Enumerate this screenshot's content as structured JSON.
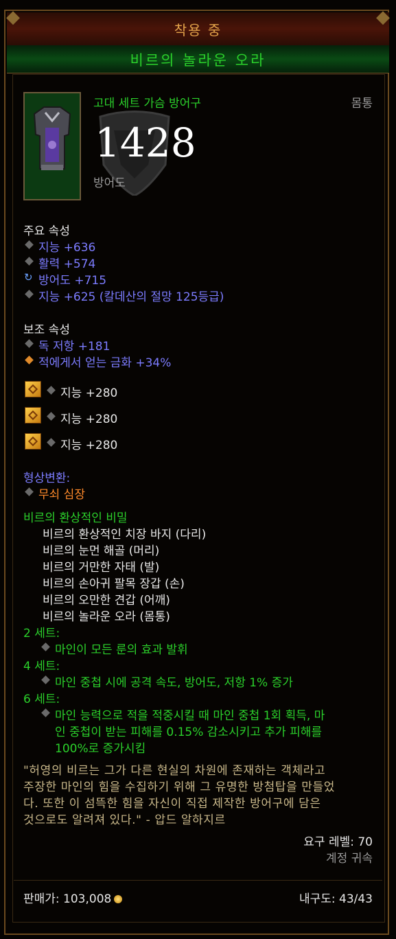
{
  "header": {
    "equipped_label": "착용 중",
    "item_name": "비르의 놀라운 오라"
  },
  "item": {
    "type": "고대 세트 가슴 방어구",
    "slot": "몸통",
    "armor_value": "1428",
    "armor_label": "방어도",
    "icon": "chest-armor-icon"
  },
  "primary": {
    "title": "주요 속성",
    "stats": [
      "지능 +636",
      "활력 +574",
      "방어도 +715",
      "지능 +625 (칼데산의 절망 125등급)"
    ]
  },
  "secondary": {
    "title": "보조 속성",
    "stats": [
      "독 저항 +181",
      "적에게서 얻는 금화 +34%"
    ]
  },
  "sockets": [
    "지능 +280",
    "지능 +280",
    "지능 +280"
  ],
  "transmog": {
    "title": "형상변환:",
    "value": "무쇠 심장"
  },
  "set": {
    "name": "비르의 환상적인 비밀",
    "pieces": [
      "비르의 환상적인 치장 바지 (다리)",
      "비르의 눈먼 해골 (머리)",
      "비르의 거만한 자태 (발)",
      "비르의 손아귀 팔목 장갑 (손)",
      "비르의 오만한 견갑 (어깨)",
      "비르의 놀라운 오라 (몸통)"
    ],
    "bonus2_title": "2 세트:",
    "bonus2": "마인이 모든 룬의 효과 발휘",
    "bonus4_title": "4 세트:",
    "bonus4": "마인 중첩 시에 공격 속도, 방어도, 저항 1% 증가",
    "bonus6_title": "6 세트:",
    "bonus6_lines": [
      "마인 능력으로 적을 적중시킬 때 마인 중첩 1회 획득, 마",
      "인 중첩이 받는 피해를 0.15% 감소시키고 추가 피해를",
      "100%로 증가시킴"
    ]
  },
  "flavor": [
    "\"허영의 비르는 그가 다른 현실의 차원에 존재하는 객체라고",
    "주장한 마인의 힘을 수집하기 위해 그 유명한 방첨탑을 만들었",
    "다. 또한 이 섬뜩한 힘을 자신이 직접 제작한 방어구에 담은",
    "것으로도 알려져 있다.\" - 압드 알하지르"
  ],
  "requirements": {
    "level": "요구 레벨: 70",
    "bound": "계정 귀속"
  },
  "footer": {
    "sell_price": "판매가: 103,008",
    "durability": "내구도: 43/43"
  },
  "colors": {
    "set_green": "#2bd12b",
    "magic_blue": "#7c7cff",
    "legendary_orange": "#ff8a2a",
    "title_gold": "#e3a34a"
  }
}
